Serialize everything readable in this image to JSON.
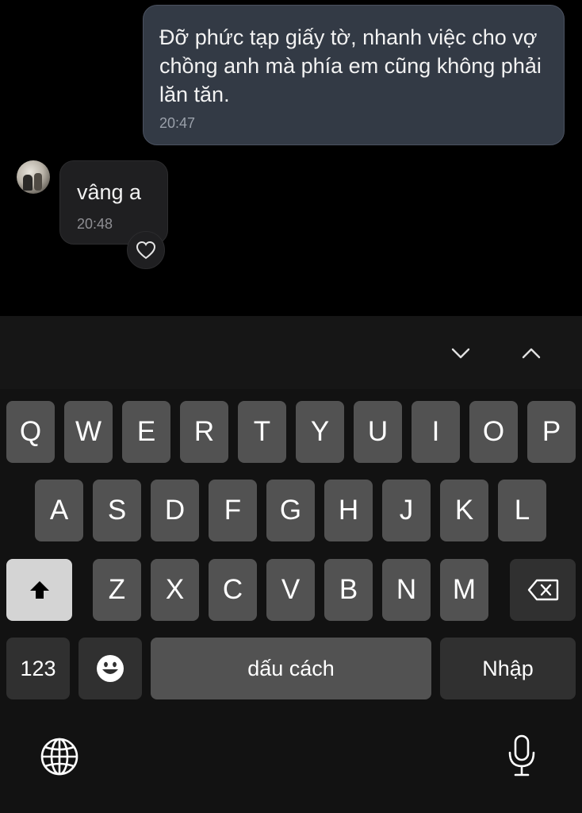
{
  "chat": {
    "outgoing": {
      "text": "Đỡ phức tạp giấy tờ, nhanh việc cho vợ chồng anh mà phía em cũng không phải lăn tăn.",
      "time": "20:47"
    },
    "incoming": {
      "text": "vâng a",
      "time": "20:48"
    }
  },
  "toolbar": {
    "down_icon": "chevron-down-icon",
    "up_icon": "chevron-up-icon"
  },
  "keyboard": {
    "row1": [
      "Q",
      "W",
      "E",
      "R",
      "T",
      "Y",
      "U",
      "I",
      "O",
      "P"
    ],
    "row2": [
      "A",
      "S",
      "D",
      "F",
      "G",
      "H",
      "J",
      "K",
      "L"
    ],
    "row3": [
      "Z",
      "X",
      "C",
      "V",
      "B",
      "N",
      "M"
    ],
    "numbers_label": "123",
    "space_label": "dấu cách",
    "return_label": "Nhập"
  },
  "colors": {
    "outgoing_bubble": "#333a45",
    "incoming_bubble": "#1f1f21",
    "key": "#525252",
    "key_dark": "#303030",
    "shift_active": "#d4d4d4"
  }
}
